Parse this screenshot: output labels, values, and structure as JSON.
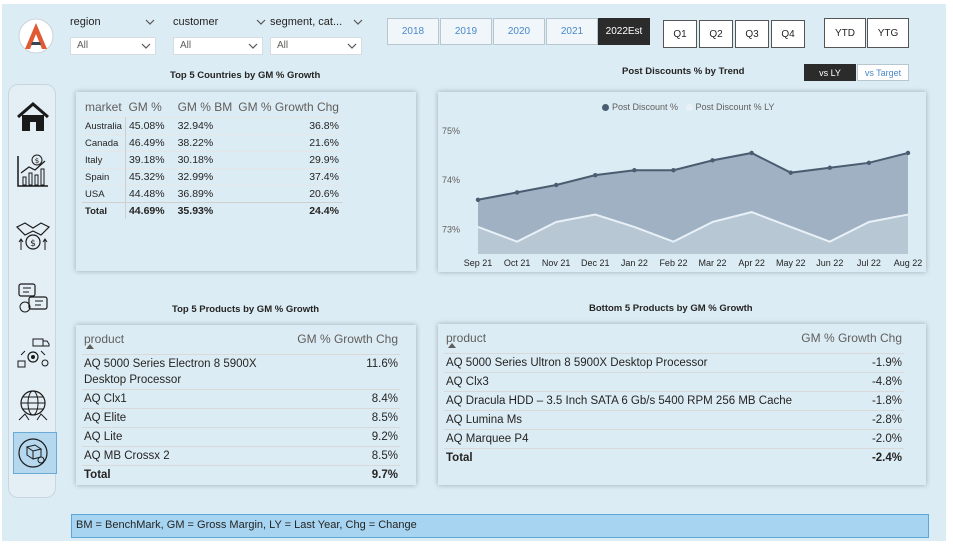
{
  "slicers": [
    {
      "label": "region",
      "value": "All"
    },
    {
      "label": "customer",
      "value": "All"
    },
    {
      "label": "segment, cat...",
      "value": "All"
    }
  ],
  "years": [
    "2018",
    "2019",
    "2020",
    "2021",
    "2022Est"
  ],
  "selected_year": "2022Est",
  "quarters": [
    "Q1",
    "Q2",
    "Q3",
    "Q4"
  ],
  "periods": [
    "YTD",
    "YTG"
  ],
  "colors": {
    "accent": "#e05a33",
    "dark": "#2b2b2b",
    "line_dark": "#4a5d70",
    "line_light": "#e8f1f7",
    "area": "#9fb1c2"
  },
  "nav_icons": [
    "home-icon",
    "finance-icon",
    "sales-icon",
    "marketing-icon",
    "supply-chain-icon",
    "executive-icon"
  ],
  "countries": {
    "title": "Top 5 Countries by GM % Growth",
    "headers": [
      "market",
      "GM %",
      "GM % BM",
      "GM % Growth Chg"
    ],
    "rows": [
      [
        "Australia",
        "45.08%",
        "32.94%",
        "36.8%"
      ],
      [
        "Canada",
        "46.49%",
        "38.22%",
        "21.6%"
      ],
      [
        "Italy",
        "39.18%",
        "30.18%",
        "29.9%"
      ],
      [
        "Spain",
        "45.32%",
        "32.99%",
        "37.4%"
      ],
      [
        "USA",
        "44.48%",
        "36.89%",
        "20.6%"
      ]
    ],
    "total": [
      "Total",
      "44.69%",
      "35.93%",
      "24.4%"
    ]
  },
  "trend": {
    "title": "Post Discounts % by Trend",
    "toggle": [
      "vs LY",
      "vs Target"
    ],
    "legend": [
      "Post Discount %",
      "Post Discount % LY"
    ]
  },
  "top_products": {
    "title": "Top 5 Products by GM % Growth",
    "headers": [
      "product",
      "GM % Growth Chg"
    ],
    "rows": [
      [
        "AQ 5000 Series Electron 8 5900X Desktop Processor",
        "11.6%"
      ],
      [
        "AQ Clx1",
        "8.4%"
      ],
      [
        "AQ Elite",
        "8.5%"
      ],
      [
        "AQ Lite",
        "9.2%"
      ],
      [
        "AQ MB Crossx 2",
        "8.5%"
      ]
    ],
    "total": [
      "Total",
      "9.7%"
    ]
  },
  "bottom_products": {
    "title": "Bottom 5 Products by GM % Growth",
    "headers": [
      "product",
      "GM % Growth Chg"
    ],
    "rows": [
      [
        "AQ 5000 Series Ultron 8 5900X Desktop Processor",
        "-1.9%"
      ],
      [
        "AQ Clx3",
        "-4.8%"
      ],
      [
        "AQ Dracula HDD – 3.5 Inch SATA 6 Gb/s 5400 RPM 256 MB Cache",
        "-1.8%"
      ],
      [
        "AQ Lumina Ms",
        "-2.8%"
      ],
      [
        "AQ Marquee P4",
        "-2.0%"
      ]
    ],
    "total": [
      "Total",
      "-2.4%"
    ]
  },
  "footer": "BM = BenchMark, GM = Gross Margin, LY = Last Year, Chg = Change",
  "chart_data": {
    "type": "area",
    "title": "Post Discounts % by Trend",
    "categories": [
      "Sep 21",
      "Oct 21",
      "Nov 21",
      "Dec 21",
      "Jan 22",
      "Feb 22",
      "Mar 22",
      "Apr 22",
      "May 22",
      "Jun 22",
      "Jul 22",
      "Aug 22"
    ],
    "yticks": [
      "73%",
      "74%",
      "75%"
    ],
    "ylim": [
      72.5,
      75.3
    ],
    "series": [
      {
        "name": "Post Discount %",
        "values": [
          73.6,
          73.75,
          73.9,
          74.1,
          74.2,
          74.2,
          74.4,
          74.55,
          74.15,
          74.25,
          74.35,
          74.55
        ]
      },
      {
        "name": "Post Discount % LY",
        "values": [
          73.05,
          72.75,
          73.15,
          73.3,
          73.05,
          72.75,
          73.15,
          73.35,
          73.05,
          72.75,
          73.15,
          73.3
        ]
      }
    ],
    "legend": "top"
  }
}
